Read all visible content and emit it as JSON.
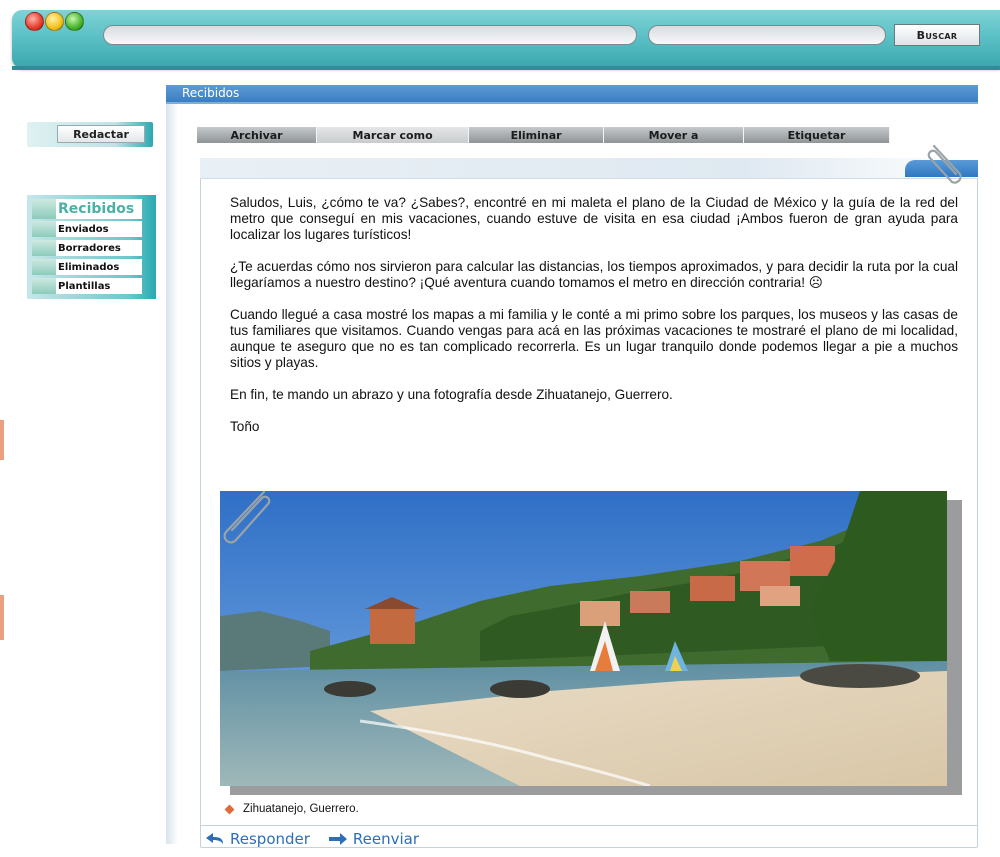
{
  "window": {
    "lights": [
      "close-light",
      "minimize-light",
      "maximize-light"
    ],
    "search_button": "Buscar"
  },
  "sidebar": {
    "compose_label": "Redactar",
    "folders": [
      {
        "label": "Recibidos",
        "active": true
      },
      {
        "label": "Enviados"
      },
      {
        "label": "Borradores"
      },
      {
        "label": "Eliminados"
      },
      {
        "label": "Plantillas"
      }
    ]
  },
  "panel": {
    "title": "Recibidos"
  },
  "toolbar": {
    "items": [
      "Archivar",
      "Marcar como",
      "Eliminar",
      "Mover a",
      "Etiquetar"
    ]
  },
  "message": {
    "paragraphs": [
      "Saludos, Luis, ¿cómo te va? ¿Sabes?, encontré en mi maleta el plano de la Ciudad de México y la guía de la red del metro que conseguí en mis vacaciones, cuando estuve de visita en esa ciudad ¡Ambos fueron de gran ayuda para localizar los lugares turísticos!",
      "¿Te acuerdas cómo nos sirvieron para calcular las distancias, los tiempos aproximados, y para decidir la ruta por la cual llegaríamos a nuestro destino? ¡Qué aventura cuando tomamos el metro en dirección contraria! ☹",
      "Cuando llegué a casa mostré los mapas a mi familia y le conté a mi primo sobre los parques, los museos y las casas de tus familiares que visitamos. Cuando vengas para acá en las próximas vacaciones te mostraré el plano de mi localidad, aunque te aseguro que no es tan complicado recorrerla. Es un lugar tranquilo donde podemos llegar a pie a muchos sitios y playas.",
      "En fin, te mando un abrazo y una fotografía desde Zihuatanejo, Guerrero.",
      "Toño"
    ],
    "photo_caption": "Zihuatanejo, Guerrero."
  },
  "actions": {
    "reply": "Responder",
    "forward": "Reenviar"
  },
  "colors": {
    "topbar": "#5cc1c6",
    "panel_header": "#3a7ec2",
    "link": "#2b6fba",
    "caption_bullet": "#e06a3c"
  }
}
